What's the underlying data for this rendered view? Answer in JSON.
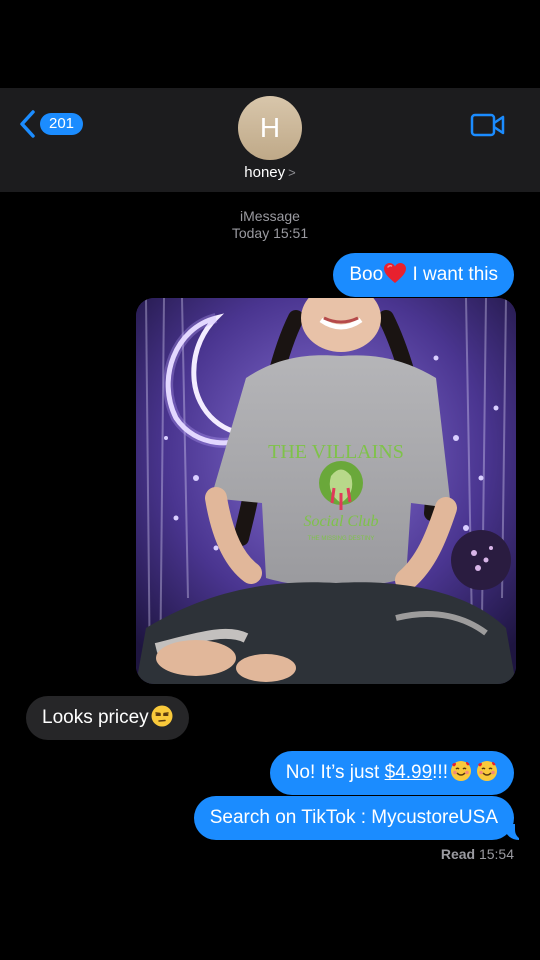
{
  "header": {
    "back_count": "201",
    "avatar_initial": "H",
    "contact_name": "honey",
    "chevron": ">"
  },
  "meta": {
    "service": "iMessage",
    "timestamp": "Today 15:51"
  },
  "messages": [
    {
      "from": "me",
      "text_before": "Boo",
      "emoji": "red-heart",
      "text_after": " I want this"
    },
    {
      "from": "me",
      "type": "photo",
      "shirt_text_top": "THE VILLAINS",
      "shirt_text_bottom": "Social Club",
      "shirt_text_small": "THE MISSING DESTINY"
    },
    {
      "from": "them",
      "text": "Looks pricey",
      "emoji": "unamused-face"
    },
    {
      "from": "me",
      "text_before": "No! It’s just ",
      "link": "$4.99",
      "text_after": "!!!",
      "emoji": "smiling-face-with-hearts"
    },
    {
      "from": "me",
      "text": "Search on TikTok : MycustoreUSA"
    }
  ],
  "receipt": {
    "label": "Read",
    "time": "15:54"
  },
  "colors": {
    "outgoing": "#1b8cff",
    "incoming": "#262628",
    "header_bg": "#1c1c1e",
    "accent": "#1b8cff"
  }
}
